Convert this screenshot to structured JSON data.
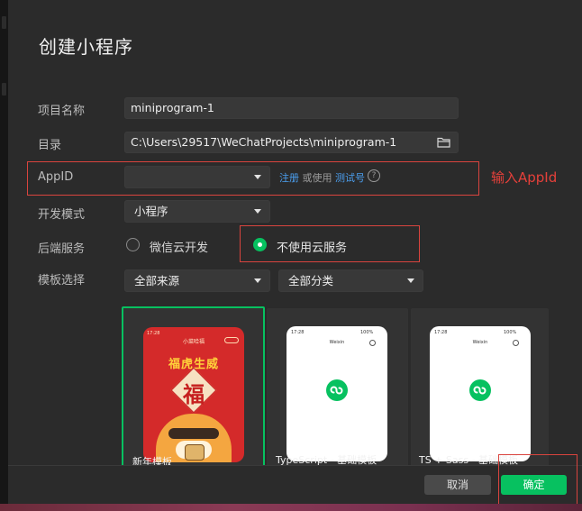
{
  "dialog": {
    "title": "创建小程序"
  },
  "form": {
    "project_name": {
      "label": "项目名称",
      "value": "miniprogram-1"
    },
    "directory": {
      "label": "目录",
      "value": "C:\\Users\\29517\\WeChatProjects\\miniprogram-1"
    },
    "appid": {
      "label": "AppID",
      "value": "",
      "register_link": "注册",
      "or_use": "或使用",
      "test_link": "测试号",
      "help": "?"
    },
    "dev_mode": {
      "label": "开发模式",
      "value": "小程序"
    },
    "backend": {
      "label": "后端服务",
      "option_cloud": "微信云开发",
      "option_no_cloud": "不使用云服务",
      "selected": "不使用云服务"
    },
    "template": {
      "label": "模板选择",
      "source_value": "全部来源",
      "category_value": "全部分类"
    }
  },
  "templates": [
    {
      "name": "新年模板",
      "selected": true,
      "phone_title": "小菜哈福",
      "banner": "福虎生威",
      "glyph": "福"
    },
    {
      "name": "TypeScript - 基础模板",
      "selected": false,
      "phone_title": "Weixin"
    },
    {
      "name": "TS + Sass - 基础模板",
      "selected": false,
      "phone_title": "Weixin"
    }
  ],
  "phone_status": {
    "time": "17:28",
    "battery": "100%"
  },
  "annotation": {
    "text": "输入AppId",
    "color": "#e5403a"
  },
  "footer": {
    "cancel": "取消",
    "confirm": "确定"
  },
  "colors": {
    "accent_green": "#07c160",
    "link_blue": "#4b9ff0",
    "annotation_red": "#d9443e"
  }
}
